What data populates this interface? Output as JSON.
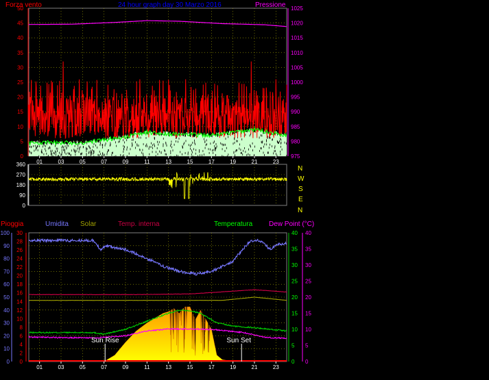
{
  "colors": {
    "wind_peak": "#ff0000",
    "wind_avg": "#00ff00",
    "wind_fill": "#ccffcc",
    "pressure": "#ff00ff",
    "direction": "#ffff00",
    "humidity": "#7777ff",
    "solar_line": "#a0a000",
    "temp_internal": "#cc0044",
    "temperature": "#00cc00",
    "dew_point": "#ff00ff",
    "rain": "#ff0000",
    "sun_top": "#ff9900",
    "sun_bottom": "#ffff00",
    "header_red": "#ff0000",
    "header_blue": "#0000ff",
    "header_magenta": "#ff00ff",
    "axis_white": "#ffffff",
    "axis_yellow": "#ffff00"
  },
  "header": {
    "wind_title": "Forza vento",
    "main_title": "24 hour graph day 30 Marzo 2016",
    "pressure_title": "Pressione"
  },
  "compass": [
    "N",
    "W",
    "S",
    "E",
    "N"
  ],
  "labels": {
    "rain": "Pioggia",
    "humidity": "Umidita",
    "solar": "Solar",
    "temp_internal": "Temp. interna",
    "temperature": "Temperatura",
    "dew_point": "Dew Point (°C)",
    "sun_rise": "Sun Rise",
    "sun_set": "Sun Set"
  },
  "chart_data": [
    {
      "type": "line",
      "name": "wind",
      "x_ticks": [
        "01",
        "03",
        "05",
        "07",
        "09",
        "11",
        "13",
        "15",
        "17",
        "19",
        "21",
        "23"
      ],
      "y_left_ticks": [
        "0",
        "5",
        "10",
        "15",
        "20",
        "25",
        "30",
        "35",
        "40",
        "45",
        "50"
      ],
      "y_right_ticks": [
        "975",
        "980",
        "985",
        "990",
        "995",
        "1000",
        "1005",
        "1010",
        "1015",
        "1020",
        "1025"
      ],
      "ylim_left": [
        0,
        50
      ],
      "ylim_right": [
        975,
        1025
      ],
      "pressure_profile": {
        "hours": [
          0,
          4,
          8,
          11,
          14,
          18,
          22,
          24
        ],
        "values": [
          1019.5,
          1019.6,
          1020.2,
          1020.8,
          1020.6,
          1019.8,
          1019.4,
          1018.8
        ]
      },
      "gust_band": [
        6,
        20
      ],
      "gust_spikes": [
        {
          "hour": 3.2,
          "value": 32
        },
        {
          "hour": 14.6,
          "value": 26
        },
        {
          "hour": 20.7,
          "value": 32
        },
        {
          "hour": 23.0,
          "value": 26
        }
      ],
      "avg_profile": {
        "hours": [
          0,
          5,
          9,
          11,
          13,
          17,
          19,
          21,
          24
        ],
        "values": [
          4.5,
          4.5,
          6.5,
          8,
          7.5,
          7,
          8,
          9,
          7
        ]
      }
    },
    {
      "type": "line",
      "name": "wind direction",
      "y_ticks": [
        "0",
        "90",
        "180",
        "270",
        "360"
      ],
      "ylim": [
        0,
        360
      ],
      "typical_value": 230,
      "typical_spread": 15,
      "disturbed_hours": [
        13,
        17
      ],
      "min_dip": 60
    },
    {
      "type": "line",
      "name": "rain humidity solar temperature",
      "x_ticks": [
        "01",
        "03",
        "05",
        "07",
        "09",
        "11",
        "13",
        "15",
        "17",
        "19",
        "21",
        "23"
      ],
      "rain_ticks": [
        "0",
        "2",
        "4",
        "6",
        "8",
        "10",
        "12",
        "14",
        "16",
        "18",
        "20",
        "22",
        "24",
        "26",
        "28",
        "30"
      ],
      "humidity_ticks": [
        "0",
        "10",
        "20",
        "30",
        "40",
        "50",
        "60",
        "70",
        "80",
        "90",
        "100"
      ],
      "temp_ticks": [
        "0",
        "5",
        "10",
        "15",
        "20",
        "25",
        "30",
        "35",
        "40"
      ],
      "dew_ticks": [
        "0",
        "5",
        "10",
        "15",
        "20",
        "25",
        "30",
        "35",
        "40"
      ],
      "rain_ylim": [
        0,
        30
      ],
      "humidity_ylim": [
        0,
        100
      ],
      "temp_ylim": [
        0,
        40
      ],
      "rain_total": 0,
      "humidity": {
        "hours": [
          0,
          6,
          6.7,
          7.2,
          9,
          11,
          12.5,
          14,
          15.5,
          17,
          19,
          20.5,
          21.5,
          22.5,
          23,
          24
        ],
        "values": [
          94,
          94,
          87,
          90,
          87,
          80,
          74,
          70,
          68,
          70,
          78,
          93,
          94,
          87,
          91,
          92
        ]
      },
      "solar_line": {
        "hours": [
          0,
          6,
          9,
          12,
          15,
          18,
          21,
          24
        ],
        "values": [
          19,
          19,
          19,
          19,
          19,
          19,
          20,
          19
        ]
      },
      "temp_internal": {
        "hours": [
          0,
          10,
          15,
          21,
          24
        ],
        "values": [
          20.8,
          20.8,
          21.0,
          22.3,
          21.6
        ]
      },
      "temperature": {
        "hours": [
          0,
          6,
          7,
          9,
          11,
          13,
          14,
          15,
          16,
          17.5,
          19,
          21,
          24
        ],
        "values": [
          9,
          9,
          8.5,
          10,
          12.5,
          15,
          16,
          15.8,
          15,
          12,
          11,
          10.5,
          9.5
        ]
      },
      "dew_point": {
        "hours": [
          0,
          6,
          9,
          11,
          13,
          15,
          17,
          20,
          22,
          24
        ],
        "values": [
          7.6,
          7.3,
          8,
          9.5,
          10.1,
          10.1,
          10,
          9,
          7.5,
          7.2
        ]
      },
      "solar_fill": {
        "hours": [
          7,
          8,
          9,
          10,
          11,
          12,
          12.5,
          13,
          13.5,
          14,
          14.5,
          15,
          15.5,
          16,
          16.5,
          17,
          17.5,
          18,
          19
        ],
        "values": [
          0,
          2,
          6,
          9.5,
          12,
          14,
          15,
          15.5,
          16.5,
          15,
          17,
          17,
          13,
          16,
          13,
          10,
          2,
          0.6,
          0
        ]
      },
      "sun_rise_hour": 7.1,
      "sun_set_hour": 19.8
    }
  ]
}
